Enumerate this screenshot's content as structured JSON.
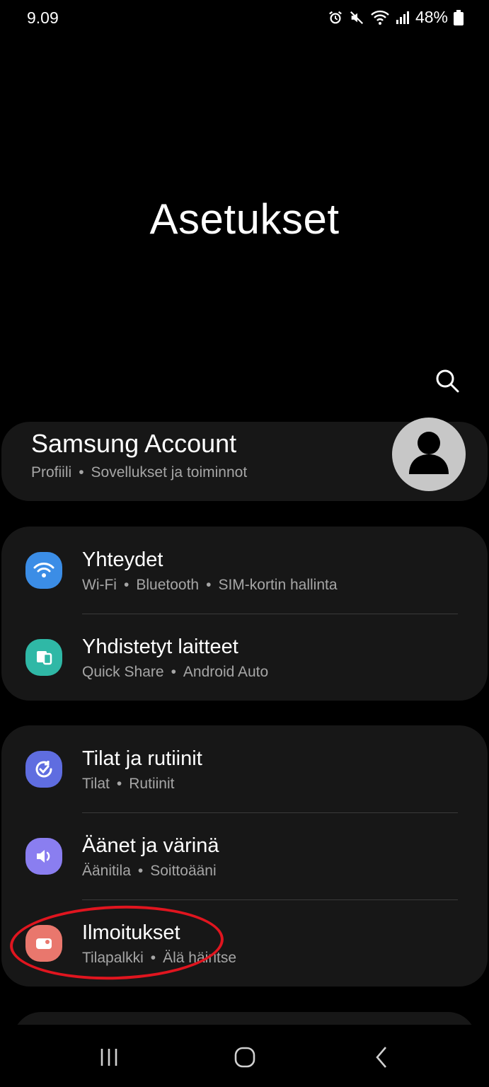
{
  "status_bar": {
    "time": "9.09",
    "battery": "48%",
    "icons": [
      "alarm-icon",
      "mute-icon",
      "wifi-icon",
      "signal-icon",
      "battery-icon"
    ]
  },
  "page": {
    "title": "Asetukset"
  },
  "account": {
    "title": "Samsung Account",
    "subtitle": [
      "Profiili",
      "Sovellukset ja toiminnot"
    ]
  },
  "settings": {
    "group1": [
      {
        "title": "Yhteydet",
        "subtitle": [
          "Wi-Fi",
          "Bluetooth",
          "SIM-kortin hallinta"
        ],
        "icon": "wifi-icon",
        "color": "#3b8de6"
      },
      {
        "title": "Yhdistetyt laitteet",
        "subtitle": [
          "Quick Share",
          "Android Auto"
        ],
        "icon": "devices-icon",
        "color": "#2fb8a6"
      }
    ],
    "group2": [
      {
        "title": "Tilat ja rutiinit",
        "subtitle": [
          "Tilat",
          "Rutiinit"
        ],
        "icon": "modes-icon",
        "color": "#5f6de0"
      },
      {
        "title": "Äänet ja värinä",
        "subtitle": [
          "Äänitila",
          "Soittoääni"
        ],
        "icon": "sound-icon",
        "color": "#8a7ef0"
      },
      {
        "title": "Ilmoitukset",
        "subtitle": [
          "Tilapalkki",
          "Älä häiritse"
        ],
        "icon": "notifications-icon",
        "color": "#e9776d"
      }
    ]
  },
  "colors": {
    "background": "#000000",
    "card": "#171717",
    "secondary_text": "#a6a6a6",
    "highlight": "#e0151f"
  }
}
